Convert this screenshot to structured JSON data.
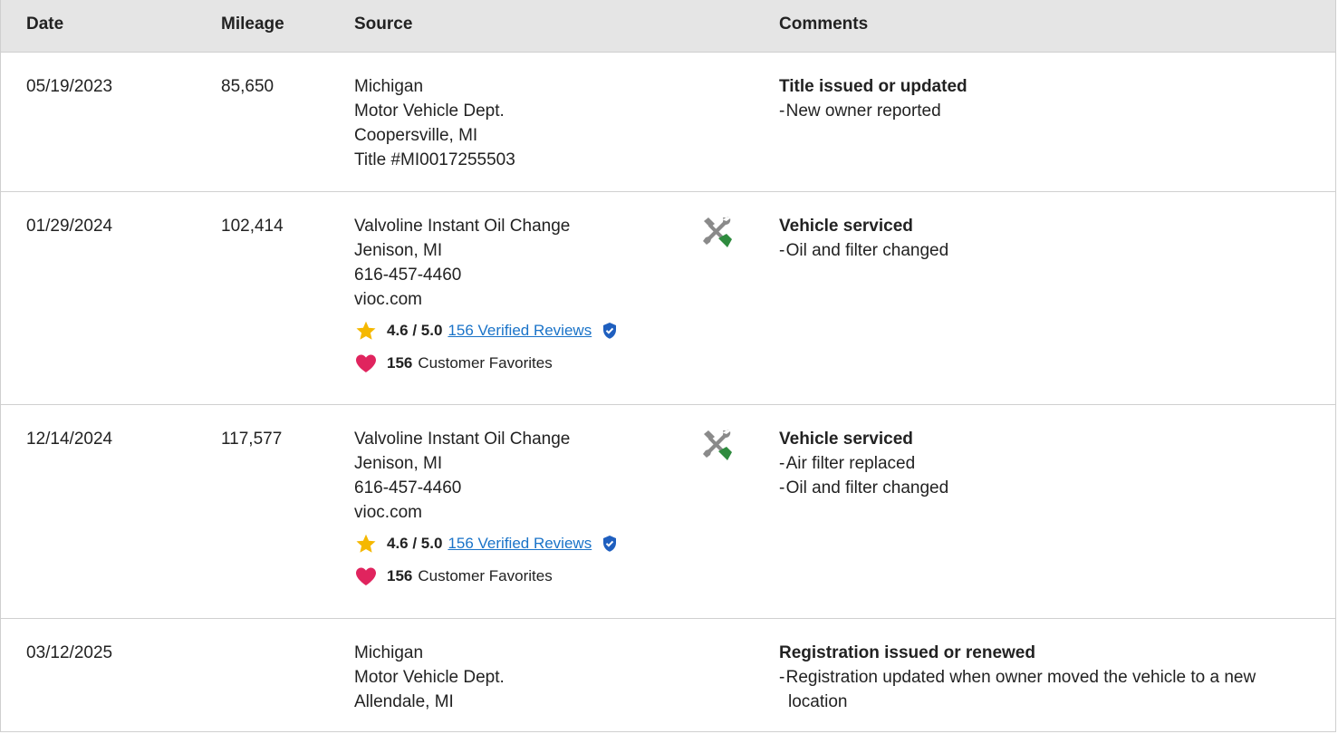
{
  "headers": {
    "date": "Date",
    "mileage": "Mileage",
    "source": "Source",
    "comments": "Comments"
  },
  "colors": {
    "header_bg": "#e5e5e5",
    "link": "#1a73c8",
    "star": "#f5b800",
    "heart": "#e0245e",
    "verified": "#1f5fbf",
    "wrench_gray": "#8a8a8a",
    "screwdriver_green": "#2e8b3e"
  },
  "rows": [
    {
      "date": "05/19/2023",
      "mileage": "85,650",
      "source": [
        "Michigan",
        "Motor Vehicle Dept.",
        "Coopersville, MI",
        "Title #MI0017255503"
      ],
      "comment_title": "Title issued or updated",
      "comment_details": [
        "New owner reported"
      ]
    },
    {
      "date": "01/29/2024",
      "mileage": "102,414",
      "source": [
        "Valvoline Instant Oil Change",
        "Jenison, MI",
        "616-457-4460",
        "vioc.com"
      ],
      "icon": "service-tools-icon",
      "rating": "4.6 / 5.0",
      "reviews_link": "156 Verified Reviews",
      "favorites_count": "156",
      "favorites_label": "Customer Favorites",
      "comment_title": "Vehicle serviced",
      "comment_details": [
        "Oil and filter changed"
      ]
    },
    {
      "date": "12/14/2024",
      "mileage": "117,577",
      "source": [
        "Valvoline Instant Oil Change",
        "Jenison, MI",
        "616-457-4460",
        "vioc.com"
      ],
      "icon": "service-tools-icon",
      "rating": "4.6 / 5.0",
      "reviews_link": "156 Verified Reviews",
      "favorites_count": "156",
      "favorites_label": "Customer Favorites",
      "comment_title": "Vehicle serviced",
      "comment_details": [
        "Air filter replaced",
        "Oil and filter changed"
      ]
    },
    {
      "date": "03/12/2025",
      "mileage": "",
      "source": [
        "Michigan",
        "Motor Vehicle Dept.",
        "Allendale, MI"
      ],
      "comment_title": "Registration issued or renewed",
      "comment_details": [
        "Registration updated when owner moved the vehicle to a new location"
      ]
    }
  ]
}
